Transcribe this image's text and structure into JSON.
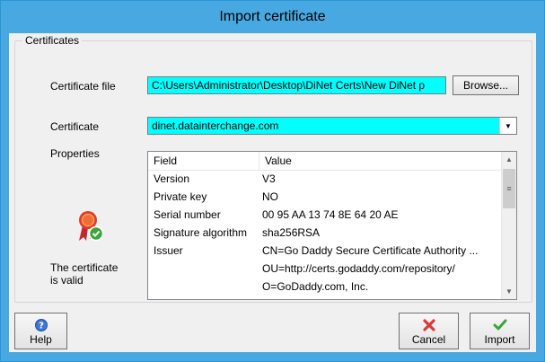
{
  "window": {
    "title": "Import certificate"
  },
  "group": {
    "title": "Certificates"
  },
  "certificate_file": {
    "label": "Certificate file",
    "value": "C:\\Users\\Administrator\\Desktop\\DiNet Certs\\New DiNet p",
    "browse_label": "Browse..."
  },
  "certificate": {
    "label": "Certificate",
    "selected": "dinet.datainterchange.com"
  },
  "properties": {
    "label": "Properties",
    "columns": [
      "Field",
      "Value"
    ],
    "rows": [
      {
        "field": "Version",
        "value": "V3"
      },
      {
        "field": "Private key",
        "value": "NO"
      },
      {
        "field": "Serial number",
        "value": "00 95 AA 13 74 8E 64 20 AE"
      },
      {
        "field": "Signature algorithm",
        "value": "sha256RSA"
      },
      {
        "field": "Issuer",
        "value": "CN=Go Daddy Secure Certificate Authority ..."
      },
      {
        "field": "",
        "value": "OU=http://certs.godaddy.com/repository/"
      },
      {
        "field": "",
        "value": "O=GoDaddy.com, Inc."
      }
    ]
  },
  "status": {
    "line1": "The certificate",
    "line2": "is valid",
    "icon": "certificate-valid-icon"
  },
  "buttons": {
    "help": "Help",
    "cancel": "Cancel",
    "import": "Import"
  },
  "colors": {
    "titlebar": "#48a9e2",
    "field_bg": "#00ffff",
    "ok_green": "#3aa63a",
    "cancel_red": "#d83b3b"
  }
}
